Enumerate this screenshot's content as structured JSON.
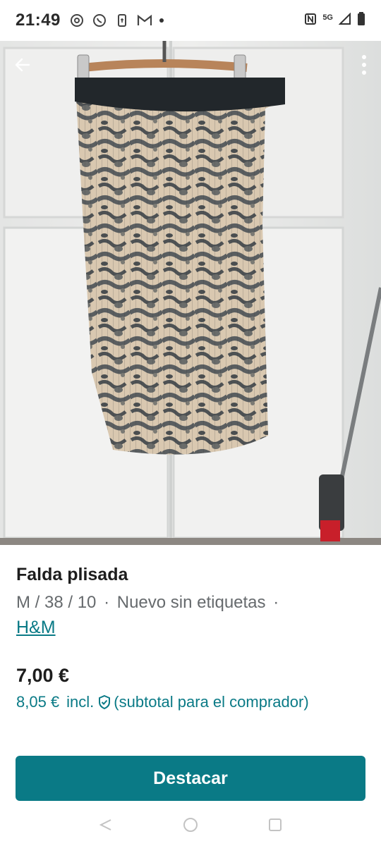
{
  "status_bar": {
    "time": "21:49",
    "network": "5G",
    "left_icons": [
      "threads-icon",
      "whatsapp-icon",
      "phone-sync-icon",
      "gmail-icon",
      "dot-icon"
    ],
    "right_icons": [
      "nfc-icon",
      "signal-icon",
      "battery-icon"
    ]
  },
  "toolbar": {
    "back_icon": "arrow-left-icon",
    "more_icon": "more-vertical-icon"
  },
  "item": {
    "title": "Falda plisada",
    "size": "M / 38 / 10",
    "separator": "·",
    "condition": "Nuevo sin etiquetas",
    "brand": "H&M",
    "price": "7,00 €",
    "price_total": "8,05 €",
    "price_incl": "incl.",
    "price_note": "(subtotal para el comprador)"
  },
  "cta": {
    "label": "Destacar"
  },
  "colors": {
    "accent": "#0a7a86",
    "text": "#1d1d1d",
    "muted": "#666a6d"
  }
}
